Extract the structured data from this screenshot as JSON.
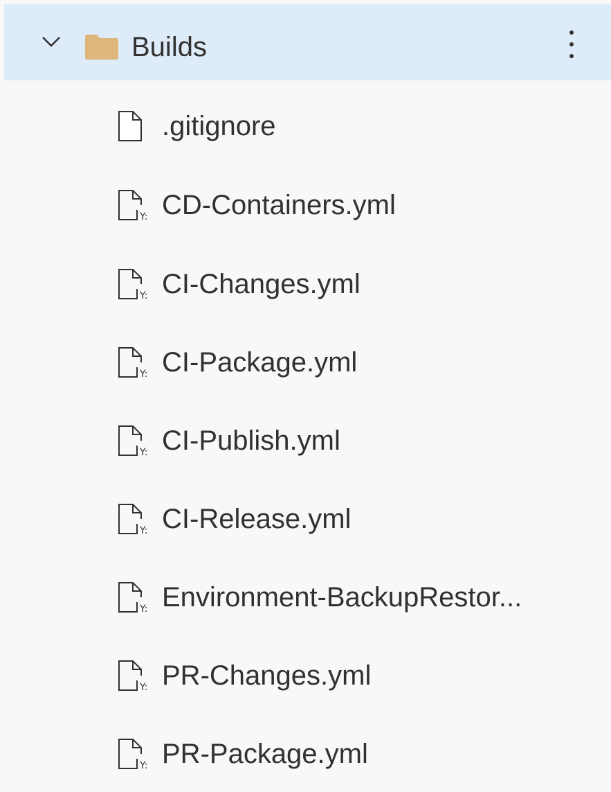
{
  "tree": {
    "folder": {
      "name": "Builds",
      "expanded": true,
      "icon": "folder-icon",
      "chevron_icon": "chevron-down-icon",
      "more_icon": "more-vertical-icon",
      "folder_color": "#dcb67a",
      "selected_bg": "#deecf9"
    },
    "files": [
      {
        "name": ".gitignore",
        "icon": "file-icon"
      },
      {
        "name": "CD-Containers.yml",
        "icon": "yaml-file-icon"
      },
      {
        "name": "CI-Changes.yml",
        "icon": "yaml-file-icon"
      },
      {
        "name": "CI-Package.yml",
        "icon": "yaml-file-icon"
      },
      {
        "name": "CI-Publish.yml",
        "icon": "yaml-file-icon"
      },
      {
        "name": "CI-Release.yml",
        "icon": "yaml-file-icon"
      },
      {
        "name": "Environment-BackupRestor...",
        "icon": "yaml-file-icon"
      },
      {
        "name": "PR-Changes.yml",
        "icon": "yaml-file-icon"
      },
      {
        "name": "PR-Package.yml",
        "icon": "yaml-file-icon"
      }
    ]
  }
}
